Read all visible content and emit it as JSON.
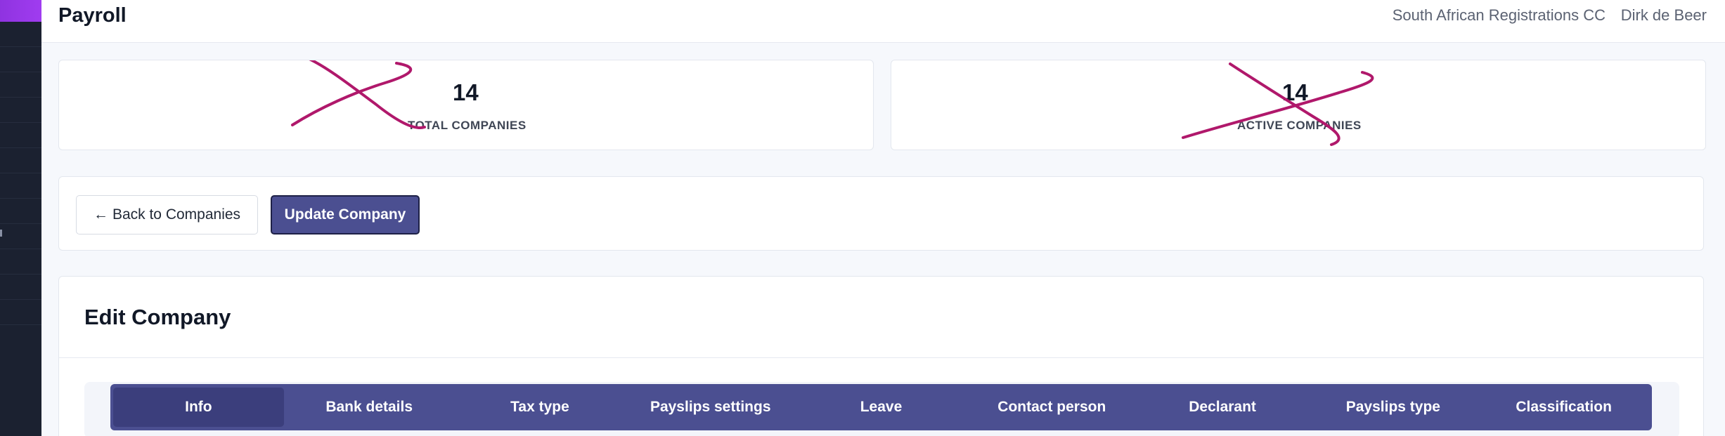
{
  "colors": {
    "accent": "#4b4f91",
    "accent_active": "#3b3e7c",
    "scribble": "#b0186b",
    "sidebar_bg": "#1b2130",
    "brand_gradient": "#9a38ea"
  },
  "header": {
    "title": "Payroll",
    "organization": "South African Registrations CC",
    "user": "Dirk de Beer"
  },
  "stats": [
    {
      "value": "14",
      "label": "TOTAL COMPANIES"
    },
    {
      "value": "14",
      "label": "ACTIVE COMPANIES"
    }
  ],
  "actions": {
    "back_icon": "←",
    "back_label": "Back to Companies",
    "update_label": "Update Company"
  },
  "edit": {
    "title": "Edit Company",
    "tabs": [
      {
        "label": "Info",
        "active": true
      },
      {
        "label": "Bank details",
        "active": false
      },
      {
        "label": "Tax type",
        "active": false
      },
      {
        "label": "Payslips settings",
        "active": false
      },
      {
        "label": "Leave",
        "active": false
      },
      {
        "label": "Contact person",
        "active": false
      },
      {
        "label": "Declarant",
        "active": false
      },
      {
        "label": "Payslips type",
        "active": false
      },
      {
        "label": "Classification",
        "active": false
      }
    ]
  }
}
